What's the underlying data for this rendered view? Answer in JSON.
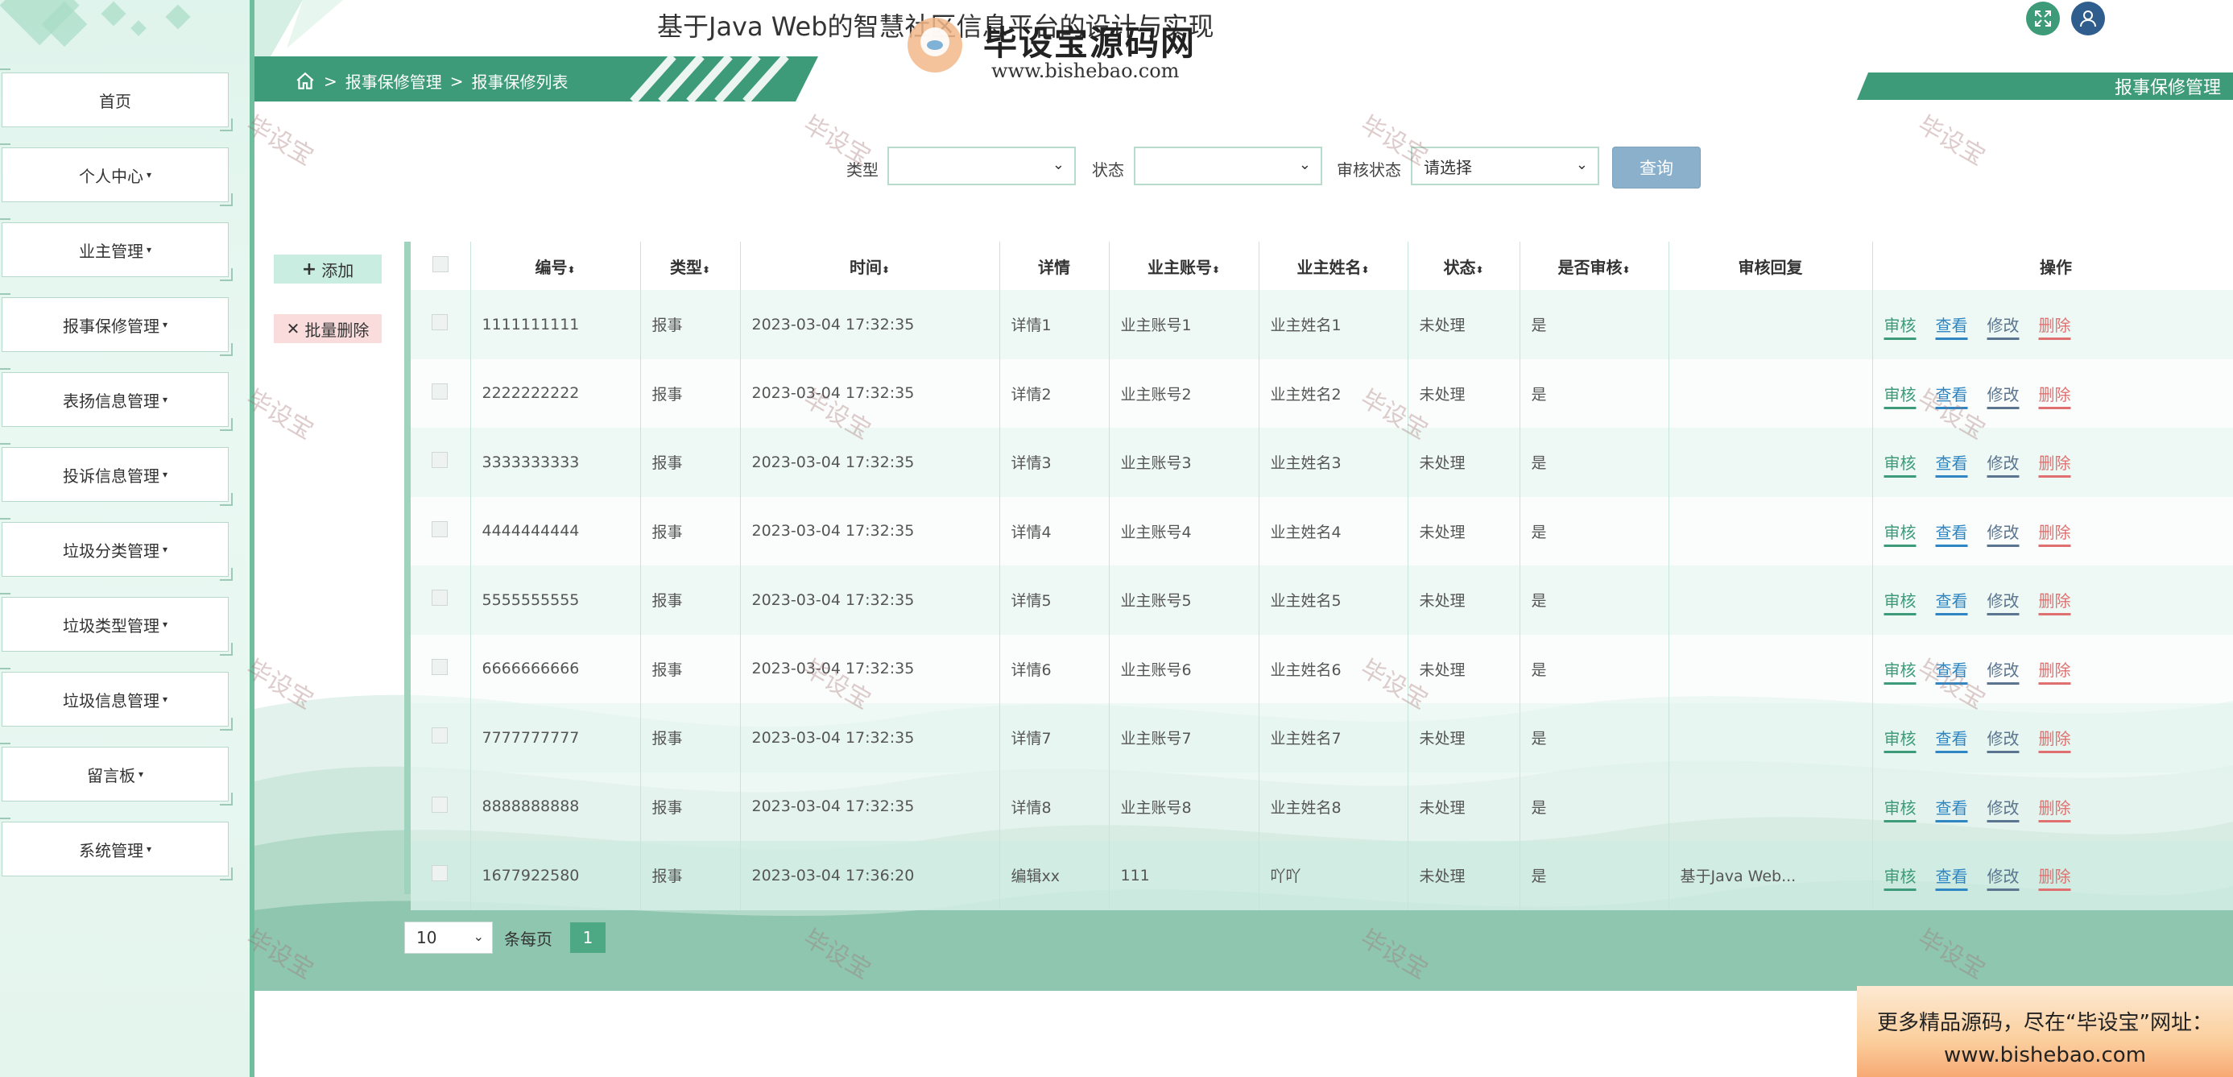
{
  "app": {
    "title": "基于Java Web的智慧社区信息平台的设计与实现",
    "logo_text": "毕设宝源码网",
    "logo_url": "www.bishebao.com"
  },
  "sidebar": {
    "items": [
      {
        "label": "首页",
        "caret": false
      },
      {
        "label": "个人中心",
        "caret": true
      },
      {
        "label": "业主管理",
        "caret": true
      },
      {
        "label": "报事保修管理",
        "caret": true
      },
      {
        "label": "表扬信息管理",
        "caret": true
      },
      {
        "label": "投诉信息管理",
        "caret": true
      },
      {
        "label": "垃圾分类管理",
        "caret": true
      },
      {
        "label": "垃圾类型管理",
        "caret": true
      },
      {
        "label": "垃圾信息管理",
        "caret": true
      },
      {
        "label": "留言板",
        "caret": true
      },
      {
        "label": "系统管理",
        "caret": true
      }
    ]
  },
  "breadcrumb": {
    "items": [
      "报事保修管理",
      "报事保修列表"
    ],
    "separator": ">"
  },
  "right_banner": "报事保修管理",
  "search": {
    "type_label": "类型",
    "type_value": "",
    "status_label": "状态",
    "status_value": "",
    "audit_label": "审核状态",
    "audit_value": "请选择",
    "query_label": "查询"
  },
  "actions": {
    "add_label": "添加",
    "batch_delete_label": "批量删除"
  },
  "table": {
    "headers": [
      "编号",
      "类型",
      "时间",
      "详情",
      "业主账号",
      "业主姓名",
      "状态",
      "是否审核",
      "审核回复",
      "操作"
    ],
    "sortable": [
      true,
      true,
      true,
      false,
      true,
      true,
      true,
      true,
      false,
      false
    ],
    "rows": [
      [
        "1111111111",
        "报事",
        "2023-03-04 17:32:35",
        "详情1",
        "业主账号1",
        "业主姓名1",
        "未处理",
        "是",
        ""
      ],
      [
        "2222222222",
        "报事",
        "2023-03-04 17:32:35",
        "详情2",
        "业主账号2",
        "业主姓名2",
        "未处理",
        "是",
        ""
      ],
      [
        "3333333333",
        "报事",
        "2023-03-04 17:32:35",
        "详情3",
        "业主账号3",
        "业主姓名3",
        "未处理",
        "是",
        ""
      ],
      [
        "4444444444",
        "报事",
        "2023-03-04 17:32:35",
        "详情4",
        "业主账号4",
        "业主姓名4",
        "未处理",
        "是",
        ""
      ],
      [
        "5555555555",
        "报事",
        "2023-03-04 17:32:35",
        "详情5",
        "业主账号5",
        "业主姓名5",
        "未处理",
        "是",
        ""
      ],
      [
        "6666666666",
        "报事",
        "2023-03-04 17:32:35",
        "详情6",
        "业主账号6",
        "业主姓名6",
        "未处理",
        "是",
        ""
      ],
      [
        "7777777777",
        "报事",
        "2023-03-04 17:32:35",
        "详情7",
        "业主账号7",
        "业主姓名7",
        "未处理",
        "是",
        ""
      ],
      [
        "8888888888",
        "报事",
        "2023-03-04 17:32:35",
        "详情8",
        "业主账号8",
        "业主姓名8",
        "未处理",
        "是",
        ""
      ],
      [
        "1677922580",
        "报事",
        "2023-03-04 17:36:20",
        "编辑xx",
        "111",
        "吖吖",
        "未处理",
        "是",
        "基于Java Web..."
      ]
    ],
    "op_labels": [
      "审核",
      "查看",
      "修改",
      "删除"
    ]
  },
  "pagination": {
    "page_size": "10",
    "per_page_label": "条每页",
    "current_page": "1"
  },
  "watermark_text": "毕设宝",
  "ad": {
    "line1": "更多精品源码，尽在“毕设宝”网址：",
    "line2": "www.bishebao.com"
  },
  "colors": {
    "primary": "#3e9b7a",
    "view": "#2f86c2",
    "delete": "#e07070",
    "query_button": "#8ab0cc"
  }
}
